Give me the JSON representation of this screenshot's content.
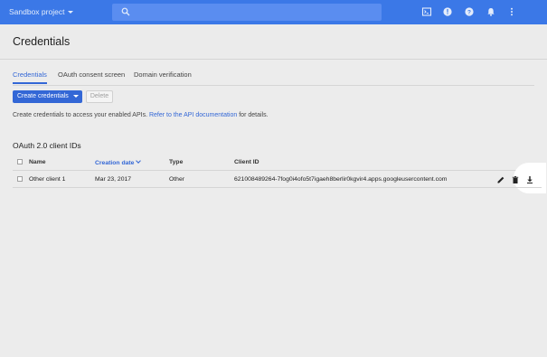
{
  "topbar": {
    "project_name": "Sandbox project",
    "search_placeholder": "",
    "icons": [
      "cloud-shell-icon",
      "notifications-feedback-icon",
      "help-icon",
      "bell-icon",
      "more-vert-icon"
    ]
  },
  "page": {
    "title": "Credentials"
  },
  "tabs": [
    {
      "label": "Credentials",
      "active": true
    },
    {
      "label": "OAuth consent screen",
      "active": false
    },
    {
      "label": "Domain verification",
      "active": false
    }
  ],
  "actions": {
    "create_label": "Create credentials",
    "delete_label": "Delete"
  },
  "info": {
    "prefix": "Create credentials to access your enabled APIs.",
    "link": "Refer to the API documentation",
    "suffix": "for details."
  },
  "oauth": {
    "section_title": "OAuth 2.0 client IDs",
    "columns": {
      "name": "Name",
      "created": "Creation date",
      "type": "Type",
      "client_id": "Client ID"
    },
    "rows": [
      {
        "name": "Other client 1",
        "created": "Mar 23, 2017",
        "type": "Other",
        "client_id": "621008489264-7fog0i4ofo5t7igaeh8berlir0kgvir4.apps.googleusercontent.com"
      }
    ]
  },
  "colors": {
    "accent": "#3367d6",
    "topbar": "#3b78e7"
  }
}
